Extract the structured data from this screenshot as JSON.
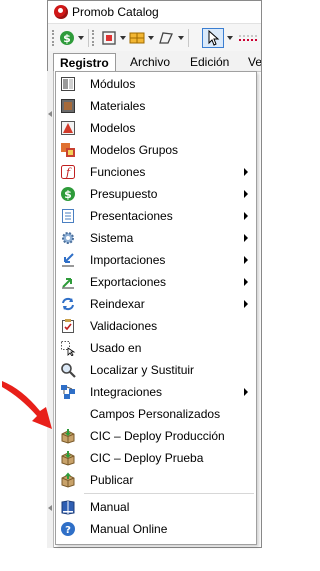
{
  "window": {
    "title": "Promob Catalog"
  },
  "toolbar": {
    "buttons": [
      {
        "name": "dollar-tool",
        "icon": "dollar-icon"
      },
      {
        "name": "frame-tool",
        "icon": "frame-icon"
      },
      {
        "name": "grid-tool",
        "icon": "grid-icon"
      },
      {
        "name": "shape-tool",
        "icon": "shape-icon"
      },
      {
        "name": "select-tool",
        "icon": "cursor-icon"
      },
      {
        "name": "measure-tool",
        "icon": "dotted-line-icon"
      }
    ]
  },
  "menubar": {
    "tabs": [
      "Registro",
      "Archivo",
      "Edición",
      "Ve"
    ]
  },
  "menu": {
    "items": [
      {
        "label": "Módulos",
        "icon": "modulos-icon",
        "submenu": false
      },
      {
        "label": "Materiales",
        "icon": "materiales-icon",
        "submenu": false
      },
      {
        "label": "Modelos",
        "icon": "modelos-icon",
        "submenu": false
      },
      {
        "label": "Modelos Grupos",
        "icon": "modelos-grupos-icon",
        "submenu": false
      },
      {
        "label": "Funciones",
        "icon": "funciones-icon",
        "submenu": true
      },
      {
        "label": "Presupuesto",
        "icon": "presupuesto-icon",
        "submenu": true
      },
      {
        "label": "Presentaciones",
        "icon": "presentaciones-icon",
        "submenu": true
      },
      {
        "label": "Sistema",
        "icon": "sistema-icon",
        "submenu": true
      },
      {
        "label": "Importaciones",
        "icon": "importaciones-icon",
        "submenu": true
      },
      {
        "label": "Exportaciones",
        "icon": "exportaciones-icon",
        "submenu": true
      },
      {
        "label": "Reindexar",
        "icon": "reindexar-icon",
        "submenu": true
      },
      {
        "label": "Validaciones",
        "icon": "validaciones-icon",
        "submenu": false
      },
      {
        "label": "Usado en",
        "icon": "usado-en-icon",
        "submenu": false
      },
      {
        "label": "Localizar y Sustituir",
        "icon": "localizar-icon",
        "submenu": false
      },
      {
        "label": "Integraciones",
        "icon": "integraciones-icon",
        "submenu": true
      },
      {
        "label": "Campos Personalizados",
        "icon": "",
        "submenu": false
      },
      {
        "label": "CIC – Deploy Producción",
        "icon": "deploy-box-icon",
        "submenu": false
      },
      {
        "label": "CIC – Deploy Prueba",
        "icon": "deploy-box-icon",
        "submenu": false
      },
      {
        "label": "Publicar",
        "icon": "publicar-box-icon",
        "submenu": false
      },
      {
        "label": "Manual",
        "icon": "manual-book-icon",
        "submenu": false
      },
      {
        "label": "Manual Online",
        "icon": "help-circle-icon",
        "submenu": false
      }
    ]
  },
  "colors": {
    "annotation_arrow": "#e8201a",
    "menu_border": "#a0a0a0",
    "selected_tool": "#3b7ed1"
  }
}
